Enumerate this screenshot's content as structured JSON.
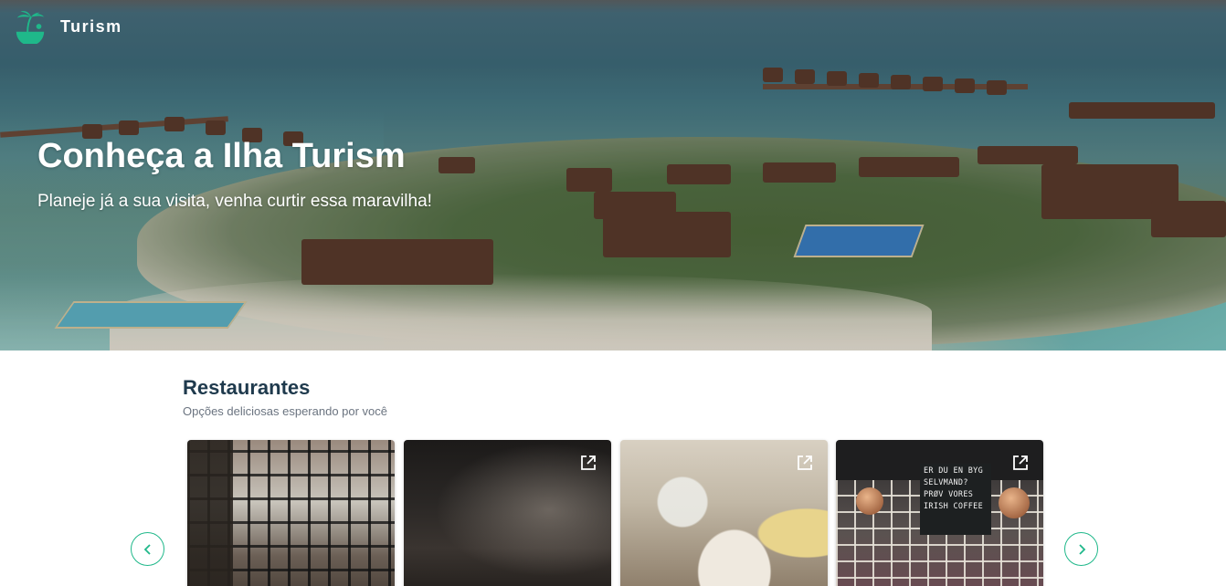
{
  "header": {
    "logo_icon": "palm-island-icon",
    "brand": "Turism"
  },
  "hero": {
    "title": "Conheça a Ilha Turism",
    "subtitle": "Planeje já a sua visita, venha curtir essa maravilha!"
  },
  "restaurants": {
    "title": "Restaurantes",
    "subtitle": "Opções deliciosas esperando por você",
    "cards": [
      {
        "icon": "external-link-icon"
      },
      {
        "icon": "external-link-icon"
      },
      {
        "icon": "external-link-icon"
      },
      {
        "icon": "external-link-icon",
        "board_text": [
          "ER DU EN BYG",
          "SELVMAND?",
          "PRØV VORES",
          "IRISH COFFEE"
        ]
      }
    ],
    "prev_icon": "chevron-left-icon",
    "next_icon": "chevron-right-icon"
  },
  "colors": {
    "accent": "#1fb88a",
    "title": "#1f3a4d",
    "subtitle": "#6b7480"
  }
}
